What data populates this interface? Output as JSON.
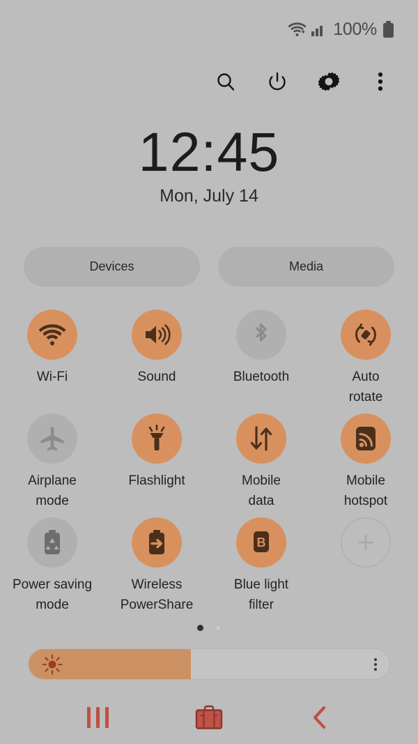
{
  "theme": {
    "background": "#bdbdbd",
    "accent_on": "#d8915e",
    "accent_off": "#b0b0b0",
    "icon_dark": "#4a2f1c",
    "nav_red": "#bf4f41",
    "slider_fill": "#cb9163"
  },
  "status_bar": {
    "wifi_icon": "wifi-icon",
    "signal_icon": "cellular-signal-icon",
    "battery_percent": "100%",
    "battery_icon": "battery-full-icon"
  },
  "header": {
    "buttons": [
      {
        "name": "search-icon",
        "label": "Search"
      },
      {
        "name": "power-icon",
        "label": "Power"
      },
      {
        "name": "settings-gear-icon",
        "label": "Settings"
      },
      {
        "name": "overflow-menu-icon",
        "label": "More options"
      }
    ]
  },
  "clock": {
    "time": "12:45",
    "date": "Mon, July 14"
  },
  "pills": [
    {
      "label": "Devices"
    },
    {
      "label": "Media"
    }
  ],
  "tiles": [
    {
      "label": "Wi-Fi",
      "icon": "wifi-icon",
      "state": "on"
    },
    {
      "label": "Sound",
      "icon": "sound-icon",
      "state": "on"
    },
    {
      "label": "Bluetooth",
      "icon": "bluetooth-icon",
      "state": "off"
    },
    {
      "label": "Auto\nrotate",
      "icon": "auto-rotate-icon",
      "state": "on"
    },
    {
      "label": "Airplane\nmode",
      "icon": "airplane-icon",
      "state": "off"
    },
    {
      "label": "Flashlight",
      "icon": "flashlight-icon",
      "state": "on"
    },
    {
      "label": "Mobile\ndata",
      "icon": "mobile-data-icon",
      "state": "on"
    },
    {
      "label": "Mobile\nhotspot",
      "icon": "mobile-hotspot-icon",
      "state": "on"
    },
    {
      "label": "Power saving\nmode",
      "icon": "power-saving-icon",
      "state": "off"
    },
    {
      "label": "Wireless\nPowerShare",
      "icon": "power-share-icon",
      "state": "on"
    },
    {
      "label": "Blue light\nfilter",
      "icon": "blue-light-filter-icon",
      "state": "on"
    },
    {
      "label": "",
      "icon": "add-button-icon",
      "state": "add"
    }
  ],
  "pagination": {
    "total": 2,
    "active_index": 0
  },
  "brightness": {
    "value_percent": 45,
    "sun_icon": "brightness-sun-icon",
    "menu_icon": "slider-overflow-icon"
  },
  "navigation": {
    "recents": "recents-icon",
    "home": "briefcase-home-icon",
    "back": "back-chevron-icon"
  }
}
